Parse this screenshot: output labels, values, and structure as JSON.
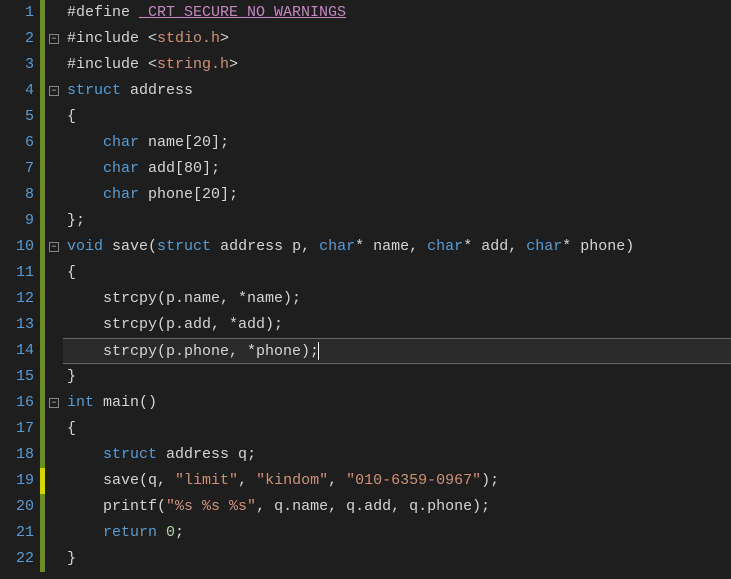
{
  "editor": {
    "lineNumbers": [
      "1",
      "2",
      "3",
      "4",
      "5",
      "6",
      "7",
      "8",
      "9",
      "10",
      "11",
      "12",
      "13",
      "14",
      "15",
      "16",
      "17",
      "18",
      "19",
      "20",
      "21",
      "22"
    ],
    "highlighted_line": 14,
    "modified_line": 19,
    "change_bar_lines": [
      1,
      2,
      3,
      4,
      5,
      6,
      7,
      8,
      9,
      10,
      11,
      12,
      13,
      14,
      15,
      16,
      17,
      18,
      19,
      20,
      21,
      22
    ],
    "fold_icons": {
      "2": "minus",
      "4": "minus",
      "10": "minus",
      "16": "minus"
    },
    "guide_cols": [
      0,
      28
    ]
  },
  "code": {
    "l1": {
      "pre": "#define ",
      "macro": "_CRT_SECURE_NO_WARNINGS"
    },
    "l2": {
      "pre": "#include ",
      "lt": "<",
      "hdr": "stdio.h",
      "gt": ">"
    },
    "l3": {
      "pre": "#include ",
      "lt": "<",
      "hdr": "string.h",
      "gt": ">"
    },
    "l4": {
      "kw": "struct",
      "name": " address"
    },
    "l5": {
      "brace": "{"
    },
    "l6": {
      "type": "char",
      "name": " name",
      "arr": "[20]",
      ";": ";"
    },
    "l7": {
      "type": "char",
      "name": " add",
      "arr": "[80]",
      ";": ";"
    },
    "l8": {
      "type": "char",
      "name": " phone",
      "arr": "[20]",
      ";": ";"
    },
    "l9": {
      "brace": "};"
    },
    "l10": {
      "ret": "void",
      "fn": " save",
      "op": "(",
      "kw1": "struct",
      "t1": " address ",
      "p1": "p",
      ", ": "",
      "t2": "char",
      "star": "* ",
      "p2": "name",
      ", 2": "",
      "t3": "char",
      "star2": "* ",
      "p3": "add",
      ", 3": "",
      "t4": "char",
      "star3": "* ",
      "p4": "phone",
      "cp": ")"
    },
    "l11": {
      "brace": "{"
    },
    "l12": {
      "fn": "strcpy",
      "args": "(p.name, *name);"
    },
    "l13": {
      "fn": "strcpy",
      "args": "(p.add, *add);"
    },
    "l14": {
      "fn": "strcpy",
      "args": "(p.phone, *phone);"
    },
    "l15": {
      "brace": "}"
    },
    "l16": {
      "ret": "int",
      "fn": " main",
      "p": "()"
    },
    "l17": {
      "brace": "{"
    },
    "l18": {
      "kw": "struct",
      "t": " address ",
      "v": "q",
      ";": ";"
    },
    "l19": {
      "fn": "save",
      "op": "(q, ",
      "s1": "\"limit\"",
      ", ": "",
      "s2": "\"kindom\"",
      ", 2": "",
      "s3": "\"010-6359-0967\"",
      "cp": ");"
    },
    "l20": {
      "fn": "printf",
      "op": "(",
      "s": "\"%s %s %s\"",
      "rest": ", q.name, q.add, q.phone);"
    },
    "l21": {
      "kw": "return ",
      "n": "0",
      ";": ";"
    },
    "l22": {
      "brace": "}"
    }
  }
}
